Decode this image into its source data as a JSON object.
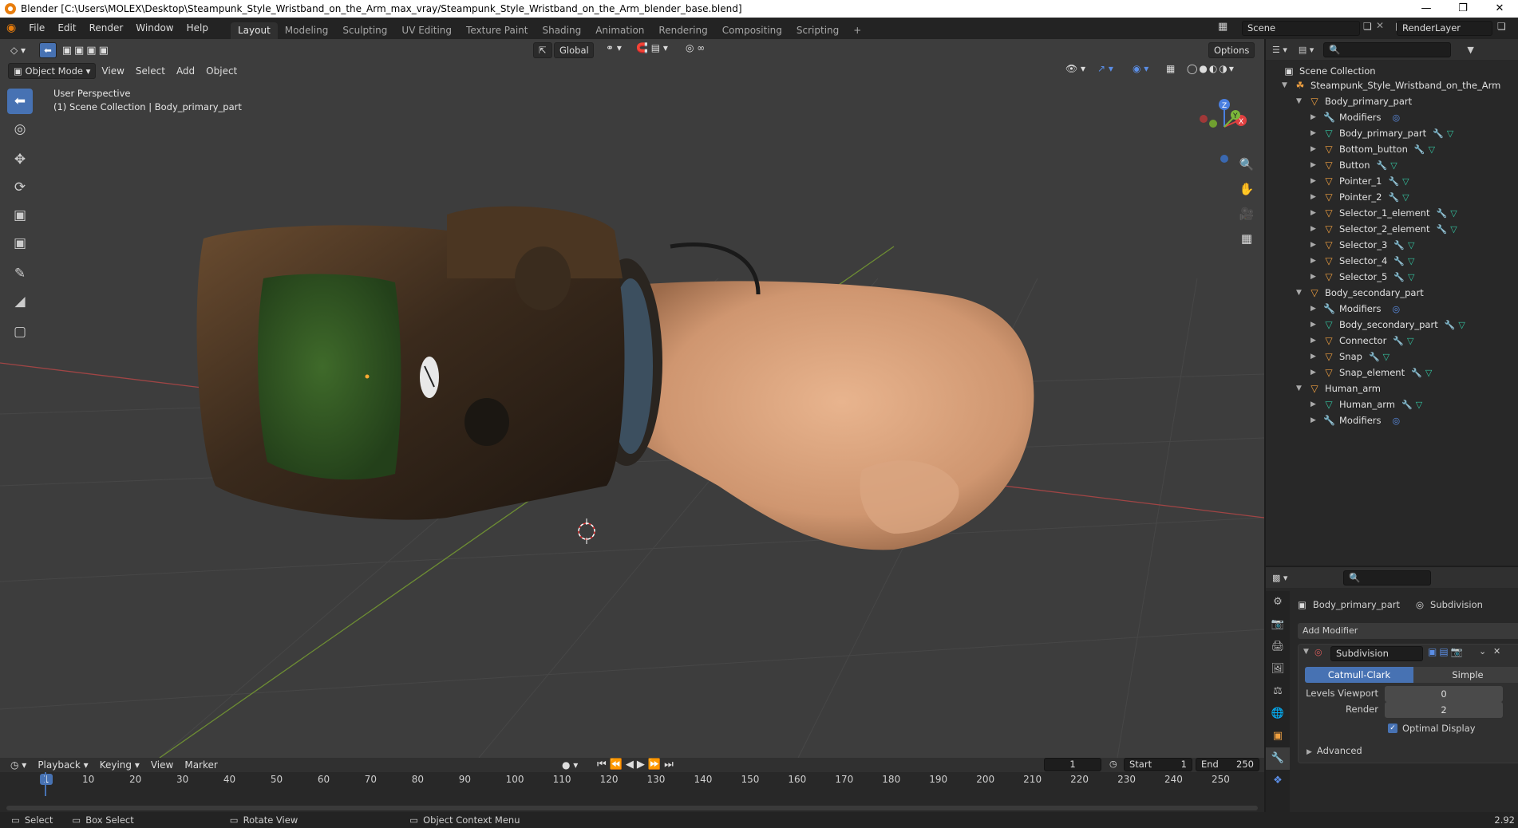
{
  "title_bar": {
    "text": "Blender [C:\\Users\\MOLEX\\Desktop\\Steampunk_Style_Wristband_on_the_Arm_max_vray/Steampunk_Style_Wristband_on_the_Arm_blender_base.blend]",
    "minimize": "—",
    "restore": "❐",
    "close": "✕"
  },
  "menu": {
    "file": "File",
    "edit": "Edit",
    "render": "Render",
    "window": "Window",
    "help": "Help"
  },
  "workspaces": [
    "Layout",
    "Modeling",
    "Sculpting",
    "UV Editing",
    "Texture Paint",
    "Shading",
    "Animation",
    "Rendering",
    "Compositing",
    "Scripting"
  ],
  "workspace_add": "+",
  "scene": {
    "name": "Scene",
    "render_layer": "RenderLayer"
  },
  "viewport_header": {
    "mode": "Object Mode",
    "view": "View",
    "select": "Select",
    "add": "Add",
    "object": "Object",
    "transform_orientation": "Global",
    "options": "Options"
  },
  "viewport": {
    "perspective_label": "User Perspective",
    "collection_label": "(1) Scene Collection | Body_primary_part",
    "gizmo": {
      "z": "Z",
      "y": "Y",
      "x": "X"
    }
  },
  "outliner": {
    "root": "Scene Collection",
    "rows": [
      {
        "label": "Steampunk_Style_Wristband_on_the_Arm",
        "icon": "☘",
        "level": 1
      },
      {
        "label": "Body_primary_part",
        "icon": "▽",
        "level": 2
      },
      {
        "label": "Modifiers",
        "icon": "🔧",
        "level": 3
      },
      {
        "label": "Body_primary_part",
        "icon": "▽",
        "level": 3
      },
      {
        "label": "Bottom_button",
        "icon": "▽",
        "level": 3
      },
      {
        "label": "Button",
        "icon": "▽",
        "level": 3
      },
      {
        "label": "Pointer_1",
        "icon": "▽",
        "level": 3
      },
      {
        "label": "Pointer_2",
        "icon": "▽",
        "level": 3
      },
      {
        "label": "Selector_1_element",
        "icon": "▽",
        "level": 3
      },
      {
        "label": "Selector_2_element",
        "icon": "▽",
        "level": 3
      },
      {
        "label": "Selector_3",
        "icon": "▽",
        "level": 3
      },
      {
        "label": "Selector_4",
        "icon": "▽",
        "level": 3
      },
      {
        "label": "Selector_5",
        "icon": "▽",
        "level": 3
      },
      {
        "label": "Body_secondary_part",
        "icon": "▽",
        "level": 2
      },
      {
        "label": "Modifiers",
        "icon": "🔧",
        "level": 3
      },
      {
        "label": "Body_secondary_part",
        "icon": "▽",
        "level": 3
      },
      {
        "label": "Connector",
        "icon": "▽",
        "level": 3
      },
      {
        "label": "Snap",
        "icon": "▽",
        "level": 3
      },
      {
        "label": "Snap_element",
        "icon": "▽",
        "level": 3
      },
      {
        "label": "Human_arm",
        "icon": "▽",
        "level": 2
      },
      {
        "label": "Human_arm",
        "icon": "▽",
        "level": 3
      },
      {
        "label": "Modifiers",
        "icon": "🔧",
        "level": 3
      }
    ]
  },
  "properties": {
    "object_name": "Body_primary_part",
    "modifier_breadcrumb": "Subdivision",
    "add_modifier": "Add Modifier",
    "modifier_name": "Subdivision",
    "catmull_clark": "Catmull-Clark",
    "simple": "Simple",
    "levels_viewport_label": "Levels Viewport",
    "levels_viewport_value": "0",
    "render_label": "Render",
    "render_value": "2",
    "optimal_display": "Optimal Display",
    "advanced": "Advanced"
  },
  "timeline": {
    "playback": "Playback",
    "keying": "Keying",
    "view": "View",
    "marker": "Marker",
    "current_frame": "1",
    "start_label": "Start",
    "start_value": "1",
    "end_label": "End",
    "end_value": "250",
    "ticks": [
      "1",
      "10",
      "20",
      "30",
      "40",
      "50",
      "60",
      "70",
      "80",
      "90",
      "100",
      "110",
      "120",
      "130",
      "140",
      "150",
      "160",
      "170",
      "180",
      "190",
      "200",
      "210",
      "220",
      "230",
      "240",
      "250"
    ]
  },
  "status_bar": {
    "select": "Select",
    "box_select": "Box Select",
    "rotate_view": "Rotate View",
    "context_menu": "Object Context Menu",
    "version": "2.92"
  }
}
